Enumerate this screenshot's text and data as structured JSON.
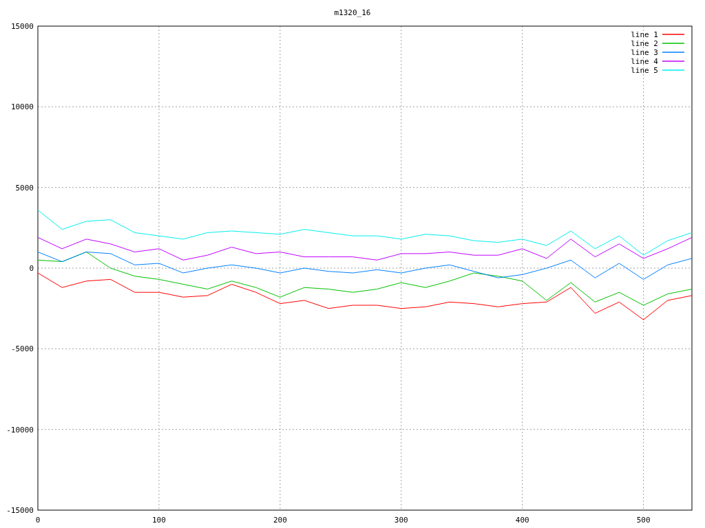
{
  "chart_data": {
    "type": "line",
    "title": "m1320_16",
    "grid": true,
    "legend": true,
    "x": [
      0,
      20,
      40,
      60,
      80,
      100,
      120,
      140,
      160,
      180,
      200,
      220,
      240,
      260,
      280,
      300,
      320,
      340,
      360,
      380,
      400,
      420,
      440,
      460,
      480,
      500,
      520,
      540
    ],
    "xlim": [
      0,
      540
    ],
    "ylim": [
      -15000,
      15000
    ],
    "xticks": [
      0,
      100,
      200,
      300,
      400,
      500
    ],
    "yticks": [
      -15000,
      -10000,
      -5000,
      0,
      5000,
      10000,
      15000
    ],
    "series": [
      {
        "name": "line 1",
        "color": "#ff0000",
        "values": [
          -300,
          -1200,
          -800,
          -700,
          -1500,
          -1500,
          -1800,
          -1700,
          -1000,
          -1500,
          -2200,
          -2000,
          -2500,
          -2300,
          -2300,
          -2500,
          -2400,
          -2100,
          -2200,
          -2400,
          -2200,
          -2100,
          -1200,
          -2800,
          -2100,
          -3200,
          -2000,
          -1700
        ]
      },
      {
        "name": "line 2",
        "color": "#00c000",
        "values": [
          500,
          400,
          1000,
          0,
          -500,
          -700,
          -1000,
          -1300,
          -800,
          -1200,
          -1800,
          -1200,
          -1300,
          -1500,
          -1300,
          -900,
          -1200,
          -800,
          -300,
          -500,
          -800,
          -2000,
          -900,
          -2100,
          -1500,
          -2300,
          -1600,
          -1300
        ]
      },
      {
        "name": "line 3",
        "color": "#0080ff",
        "values": [
          1000,
          400,
          1000,
          900,
          200,
          300,
          -300,
          0,
          200,
          0,
          -300,
          0,
          -200,
          -300,
          -100,
          -300,
          0,
          200,
          -200,
          -600,
          -400,
          0,
          500,
          -600,
          300,
          -700,
          200,
          600
        ]
      },
      {
        "name": "line 4",
        "color": "#c000ff",
        "values": [
          1900,
          1200,
          1800,
          1500,
          1000,
          1200,
          500,
          800,
          1300,
          900,
          1000,
          700,
          700,
          700,
          500,
          900,
          900,
          1000,
          800,
          800,
          1200,
          600,
          1800,
          700,
          1500,
          600,
          1200,
          1900
        ]
      },
      {
        "name": "line 5",
        "color": "#00eeee",
        "values": [
          3600,
          2400,
          2900,
          3000,
          2200,
          2000,
          1800,
          2200,
          2300,
          2200,
          2100,
          2400,
          2200,
          2000,
          2000,
          1800,
          2100,
          2000,
          1700,
          1600,
          1800,
          1400,
          2300,
          1200,
          2000,
          800,
          1700,
          2200
        ]
      }
    ]
  }
}
